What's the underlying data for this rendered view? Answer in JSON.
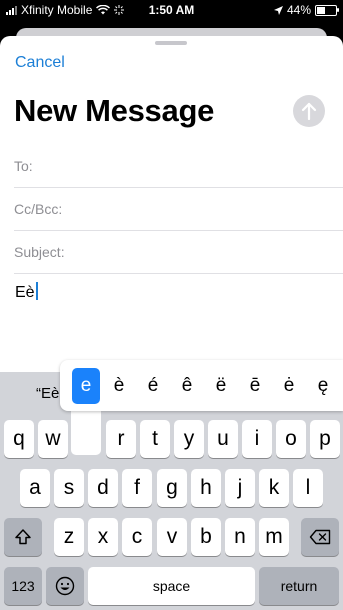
{
  "status_bar": {
    "carrier": "Xfinity Mobile",
    "time": "1:50 AM",
    "battery": "44%",
    "battery_level": 0.44
  },
  "compose": {
    "cancel_label": "Cancel",
    "title": "New Message",
    "to_label": "To:",
    "ccbcc_label": "Cc/Bcc:",
    "subject_label": "Subject:",
    "body_text": "Eè"
  },
  "keyboard": {
    "suggestion": "“Eè",
    "accent_options": [
      "e",
      "è",
      "é",
      "ê",
      "ë",
      "ē",
      "ė",
      "ę"
    ],
    "selected_accent": "e",
    "row1": [
      "q",
      "w",
      "e",
      "r",
      "t",
      "y",
      "u",
      "i",
      "o",
      "p"
    ],
    "row2": [
      "a",
      "s",
      "d",
      "f",
      "g",
      "h",
      "j",
      "k",
      "l"
    ],
    "row3": [
      "z",
      "x",
      "c",
      "v",
      "b",
      "n",
      "m"
    ],
    "numbers_label": "123",
    "space_label": "space",
    "return_label": "return"
  },
  "icons": {
    "signal": "signal-icon",
    "wifi": "wifi-icon",
    "location": "location-icon",
    "send": "send-arrow-icon",
    "shift": "shift-icon",
    "delete": "delete-icon",
    "emoji": "emoji-icon"
  },
  "colors": {
    "accent": "#1c7fd6",
    "selected_key": "#1a82fb",
    "keyboard_bg": "#d2d4d9"
  }
}
